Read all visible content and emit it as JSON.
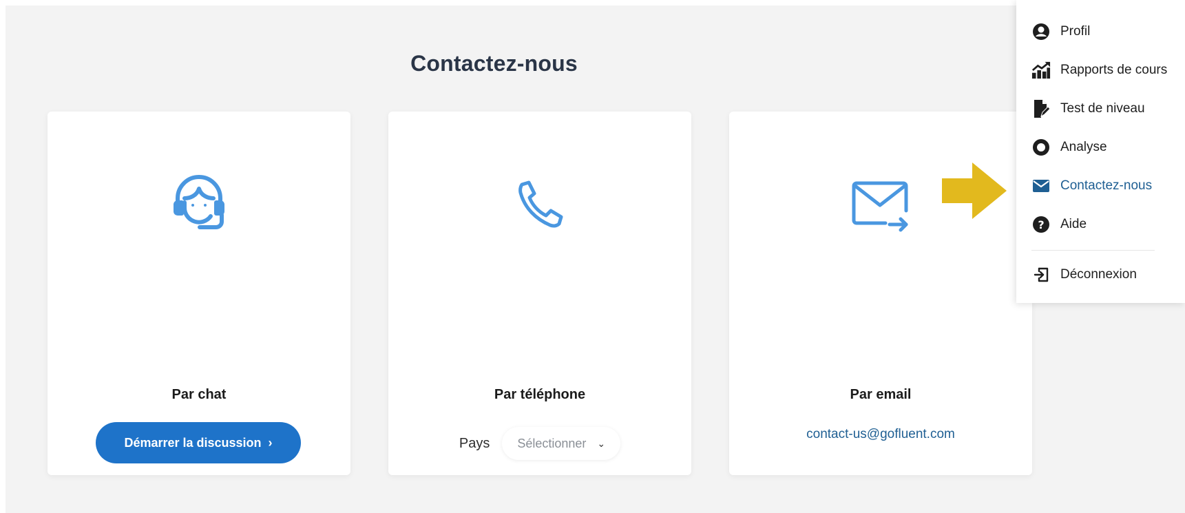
{
  "page": {
    "title": "Contactez-nous"
  },
  "cards": {
    "chat": {
      "title": "Par chat",
      "button_label": "Démarrer la discussion",
      "icon": "headset-icon"
    },
    "phone": {
      "title": "Par téléphone",
      "country_label": "Pays",
      "select_value": "Sélectionner",
      "icon": "phone-icon"
    },
    "email": {
      "title": "Par email",
      "address": "contact-us@gofluent.com",
      "icon": "mail-send-icon"
    }
  },
  "menu": {
    "items": [
      {
        "label": "Profil",
        "icon": "user-circle-icon"
      },
      {
        "label": "Rapports de cours",
        "icon": "chart-up-icon"
      },
      {
        "label": "Test de niveau",
        "icon": "document-edit-icon"
      },
      {
        "label": "Analyse",
        "icon": "ring-chart-icon"
      },
      {
        "label": "Contactez-nous",
        "icon": "envelope-icon",
        "active": true
      },
      {
        "label": "Aide",
        "icon": "question-circle-icon"
      }
    ],
    "logout": {
      "label": "Déconnexion",
      "icon": "logout-icon"
    }
  },
  "colors": {
    "accent": "#1e73c9",
    "icon_blue": "#4a97e0",
    "link": "#1f5f93",
    "arrow": "#e2b91e",
    "background": "#f3f3f3"
  }
}
